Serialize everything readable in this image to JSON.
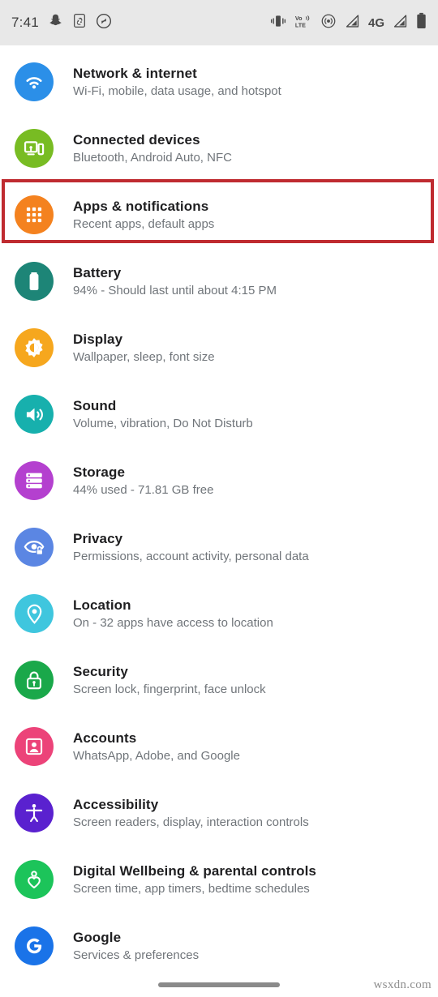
{
  "status_bar": {
    "clock": "7:41",
    "left_icons": [
      "snapchat-icon",
      "screenshot-icon",
      "shazam-icon"
    ],
    "right_icons": [
      "vibrate-icon",
      "volte-icon",
      "hotspot-icon",
      "signal-1-icon",
      "network-4g-icon",
      "signal-2-icon",
      "battery-icon"
    ],
    "volte_label": "VoLTE",
    "network_label": "4G",
    "background": "#e8e8e8"
  },
  "highlight": {
    "target": "Apps & notifications",
    "color": "#bf2b30"
  },
  "settings": {
    "items": [
      {
        "title": "Network & internet",
        "subtitle": "Wi-Fi, mobile, data usage, and hotspot",
        "icon": "wifi-icon",
        "color": "#2b8fe8",
        "name": "network-and-internet"
      },
      {
        "title": "Connected devices",
        "subtitle": "Bluetooth, Android Auto, NFC",
        "icon": "connected-devices-icon",
        "color": "#78bc23",
        "name": "connected-devices"
      },
      {
        "title": "Apps & notifications",
        "subtitle": "Recent apps, default apps",
        "icon": "apps-grid-icon",
        "color": "#f4821f",
        "name": "apps-and-notifications"
      },
      {
        "title": "Battery",
        "subtitle": "94% - Should last until about 4:15 PM",
        "icon": "battery-icon",
        "color": "#1d8577",
        "name": "battery"
      },
      {
        "title": "Display",
        "subtitle": "Wallpaper, sleep, font size",
        "icon": "brightness-icon",
        "color": "#f6a71e",
        "name": "display"
      },
      {
        "title": "Sound",
        "subtitle": "Volume, vibration, Do Not Disturb",
        "icon": "volume-icon",
        "color": "#17b0ad",
        "name": "sound"
      },
      {
        "title": "Storage",
        "subtitle": "44% used - 71.81 GB free",
        "icon": "storage-icon",
        "color": "#b440cf",
        "name": "storage"
      },
      {
        "title": "Privacy",
        "subtitle": "Permissions, account activity, personal data",
        "icon": "privacy-eye-lock-icon",
        "color": "#5b86e3",
        "name": "privacy"
      },
      {
        "title": "Location",
        "subtitle": "On - 32 apps have access to location",
        "icon": "location-pin-icon",
        "color": "#3fc6de",
        "name": "location"
      },
      {
        "title": "Security",
        "subtitle": "Screen lock, fingerprint, face unlock",
        "icon": "lock-icon",
        "color": "#1aa84a",
        "name": "security"
      },
      {
        "title": "Accounts",
        "subtitle": "WhatsApp, Adobe, and Google",
        "icon": "account-portrait-icon",
        "color": "#ec4379",
        "name": "accounts"
      },
      {
        "title": "Accessibility",
        "subtitle": "Screen readers, display, interaction controls",
        "icon": "accessibility-person-icon",
        "color": "#5a21cf",
        "name": "accessibility"
      },
      {
        "title": "Digital Wellbeing & parental controls",
        "subtitle": "Screen time, app timers, bedtime schedules",
        "icon": "wellbeing-heart-icon",
        "color": "#1cc45a",
        "name": "digital-wellbeing"
      },
      {
        "title": "Google",
        "subtitle": "Services & preferences",
        "icon": "google-g-icon",
        "color": "#1a73e8",
        "name": "google"
      }
    ]
  },
  "navigation": {
    "gesture_pill": "home-gesture-pill"
  },
  "watermark": {
    "text": "wsxdn.com"
  }
}
